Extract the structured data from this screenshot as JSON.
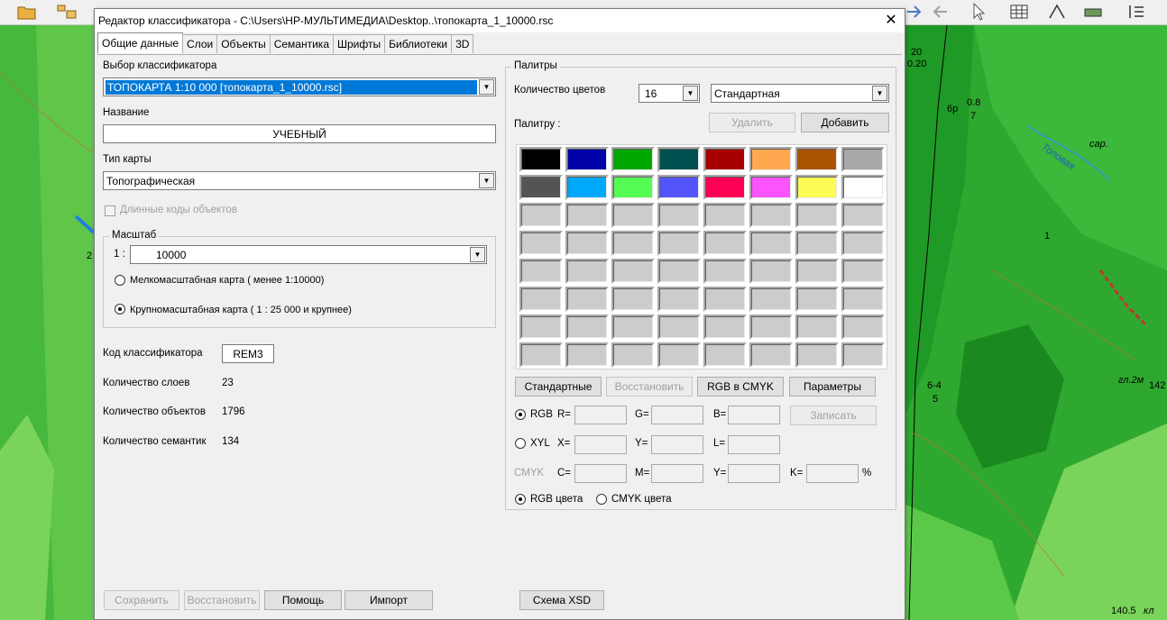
{
  "dialog": {
    "title": "Редактор классификатора - C:\\Users\\HP-МУЛЬТИМЕДИА\\Desktop..\\топокарта_1_10000.rsc",
    "close_symbol": "✕"
  },
  "tabs": [
    "Общие данные",
    "Слои",
    "Объекты",
    "Семантика",
    "Шрифты",
    "Библиотеки",
    "3D"
  ],
  "left": {
    "classifier_label": "Выбор классификатора",
    "classifier_value": "ТОПОКАРТА 1:10 000 [топокарта_1_10000.rsc]",
    "name_label": "Название",
    "name_value": "УЧЕБНЫЙ",
    "map_type_label": "Тип карты",
    "map_type_value": "Топографическая",
    "long_codes_label": "Длинные коды объектов",
    "scale_group": "Масштаб",
    "scale_prefix": "1 :",
    "scale_value": "10000",
    "small_scale_label": "Мелкомасштабная карта ( менее 1:10000)",
    "large_scale_label": "Крупномасштабная карта ( 1 : 25 000 и крупнее)",
    "code_label": "Код классификатора",
    "code_value": "REM3",
    "layers_label": "Количество слоев",
    "layers_value": "23",
    "objects_label": "Количество объектов",
    "objects_value": "1796",
    "semantics_label": "Количество семантик",
    "semantics_value": "134"
  },
  "palettes": {
    "group": "Палитры",
    "colors_count_label": "Количество цветов",
    "colors_count_value": "16",
    "palette_select_value": "Стандартная",
    "palette_label": "Палитру :",
    "delete_button": "Удалить",
    "add_button": "Добавить",
    "swatches_row1": [
      "#000000",
      "#0000a8",
      "#00a800",
      "#005050",
      "#a80000",
      "#ffa850",
      "#a85400",
      "#a8a8a8"
    ],
    "swatches_row2": [
      "#545454",
      "#00a8fc",
      "#54fc54",
      "#5454fc",
      "#fc0054",
      "#fc54fc",
      "#fcfc54",
      "#ffffff"
    ],
    "swatch_empty": "#cccccc",
    "standard_button": "Стандартные",
    "restore_button": "Восстановить",
    "rgb_to_cmyk_button": "RGB в CMYK",
    "params_button": "Параметры",
    "rgb_label": "RGB",
    "r_label": "R=",
    "g_label": "G=",
    "b_label": "B=",
    "write_button": "Записать",
    "xyl_label": "XYL",
    "x_label": "X=",
    "y_label": "Y=",
    "l_label": "L=",
    "cmyk_label": "CMYK",
    "c_label": "C=",
    "m_label": "M=",
    "cy_label": "Y=",
    "k_label": "K=",
    "percent": "%",
    "rgb_colors_label": "RGB цвета",
    "cmyk_colors_label": "CMYK цвета"
  },
  "bottom": {
    "save_button": "Сохранить",
    "restore_button": "Восстановить",
    "help_button": "Помощь",
    "import_button": "Импорт",
    "xsd_button": "Схема XSD"
  },
  "map": {
    "labels": [
      "20",
      "0.20",
      "6р",
      "0.8",
      "7",
      "сар.",
      "Топовая",
      "1",
      "6-4",
      "5",
      "гл.2м",
      "142",
      "140.5",
      "кл",
      "2"
    ]
  },
  "colors": {
    "accent": "#0078d7",
    "map_green": "#3fb33a",
    "map_dark_green": "#1f8a1f",
    "map_light_green": "#7ad35a"
  }
}
